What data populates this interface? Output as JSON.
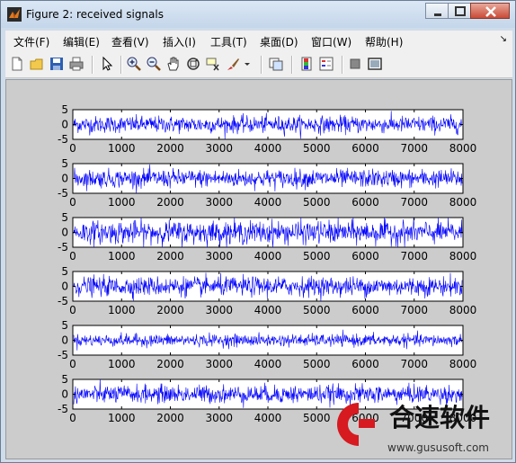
{
  "window": {
    "title": "Figure 2: received signals",
    "controls": {
      "minimize": "minimize",
      "maximize": "maximize",
      "close": "close"
    }
  },
  "menubar": {
    "items": [
      "文件(F)",
      "编辑(E)",
      "查看(V)",
      "插入(I)",
      "工具(T)",
      "桌面(D)",
      "窗口(W)",
      "帮助(H)"
    ]
  },
  "toolbar": {
    "buttons": [
      "new-figure-icon",
      "open-file-icon",
      "save-icon",
      "print-icon",
      "pointer-icon",
      "zoom-in-icon",
      "zoom-out-icon",
      "pan-hand-icon",
      "rotate-3d-icon",
      "data-cursor-icon",
      "brush-icon",
      "brush-dropdown-icon",
      "link-plot-icon",
      "insert-colorbar-icon",
      "insert-legend-icon",
      "hide-plot-tools-icon",
      "show-plot-tools-icon"
    ]
  },
  "colors": {
    "line": "#0000ff",
    "figure_bg": "#cccccc",
    "axes_bg": "#ffffff"
  },
  "chart_data": [
    {
      "type": "line",
      "x": [
        0,
        8000
      ],
      "xlim": [
        0,
        8000
      ],
      "ylim": [
        -5,
        5
      ],
      "xticks": [
        "0",
        "1000",
        "2000",
        "3000",
        "4000",
        "5000",
        "6000",
        "7000",
        "8000"
      ],
      "yticks": [
        "5",
        "0",
        "-5"
      ],
      "series": [
        {
          "amplitude_rms": 1.4,
          "values": "noise-like signal, 8000 samples"
        }
      ]
    },
    {
      "type": "line",
      "x": [
        0,
        8000
      ],
      "xlim": [
        0,
        8000
      ],
      "ylim": [
        -5,
        5
      ],
      "xticks": [
        "0",
        "1000",
        "2000",
        "3000",
        "4000",
        "5000",
        "6000",
        "7000",
        "8000"
      ],
      "yticks": [
        "5",
        "0",
        "-5"
      ],
      "series": [
        {
          "amplitude_rms": 1.5,
          "values": "noise-like signal, 8000 samples"
        }
      ]
    },
    {
      "type": "line",
      "x": [
        0,
        8000
      ],
      "xlim": [
        0,
        8000
      ],
      "ylim": [
        -5,
        5
      ],
      "xticks": [
        "0",
        "1000",
        "2000",
        "3000",
        "4000",
        "5000",
        "6000",
        "7000",
        "8000"
      ],
      "yticks": [
        "5",
        "0",
        "-5"
      ],
      "series": [
        {
          "amplitude_rms": 1.9,
          "values": "noise-like signal, 8000 samples"
        }
      ]
    },
    {
      "type": "line",
      "x": [
        0,
        8000
      ],
      "xlim": [
        0,
        8000
      ],
      "ylim": [
        -5,
        5
      ],
      "xticks": [
        "0",
        "1000",
        "2000",
        "3000",
        "4000",
        "5000",
        "6000",
        "7000",
        "8000"
      ],
      "yticks": [
        "5",
        "0",
        "-5"
      ],
      "series": [
        {
          "amplitude_rms": 1.6,
          "values": "noise-like signal, 8000 samples"
        }
      ]
    },
    {
      "type": "line",
      "x": [
        0,
        8000
      ],
      "xlim": [
        0,
        8000
      ],
      "ylim": [
        -5,
        5
      ],
      "xticks": [
        "0",
        "1000",
        "2000",
        "3000",
        "4000",
        "5000",
        "6000",
        "7000",
        "8000"
      ],
      "yticks": [
        "5",
        "0",
        "-5"
      ],
      "series": [
        {
          "amplitude_rms": 1.0,
          "values": "noise-like signal, 8000 samples"
        }
      ]
    },
    {
      "type": "line",
      "x": [
        0,
        8000
      ],
      "xlim": [
        0,
        8000
      ],
      "ylim": [
        -5,
        5
      ],
      "xticks": [
        "0",
        "1000",
        "2000",
        "3000",
        "4000",
        "5000",
        "6000",
        "7000",
        "8000"
      ],
      "yticks": [
        "5",
        "0",
        "-5"
      ],
      "series": [
        {
          "amplitude_rms": 1.5,
          "values": "noise-like signal, 8000 samples"
        }
      ]
    }
  ],
  "watermark": {
    "brand": "合速软件",
    "url": "www.gususoft.com"
  }
}
